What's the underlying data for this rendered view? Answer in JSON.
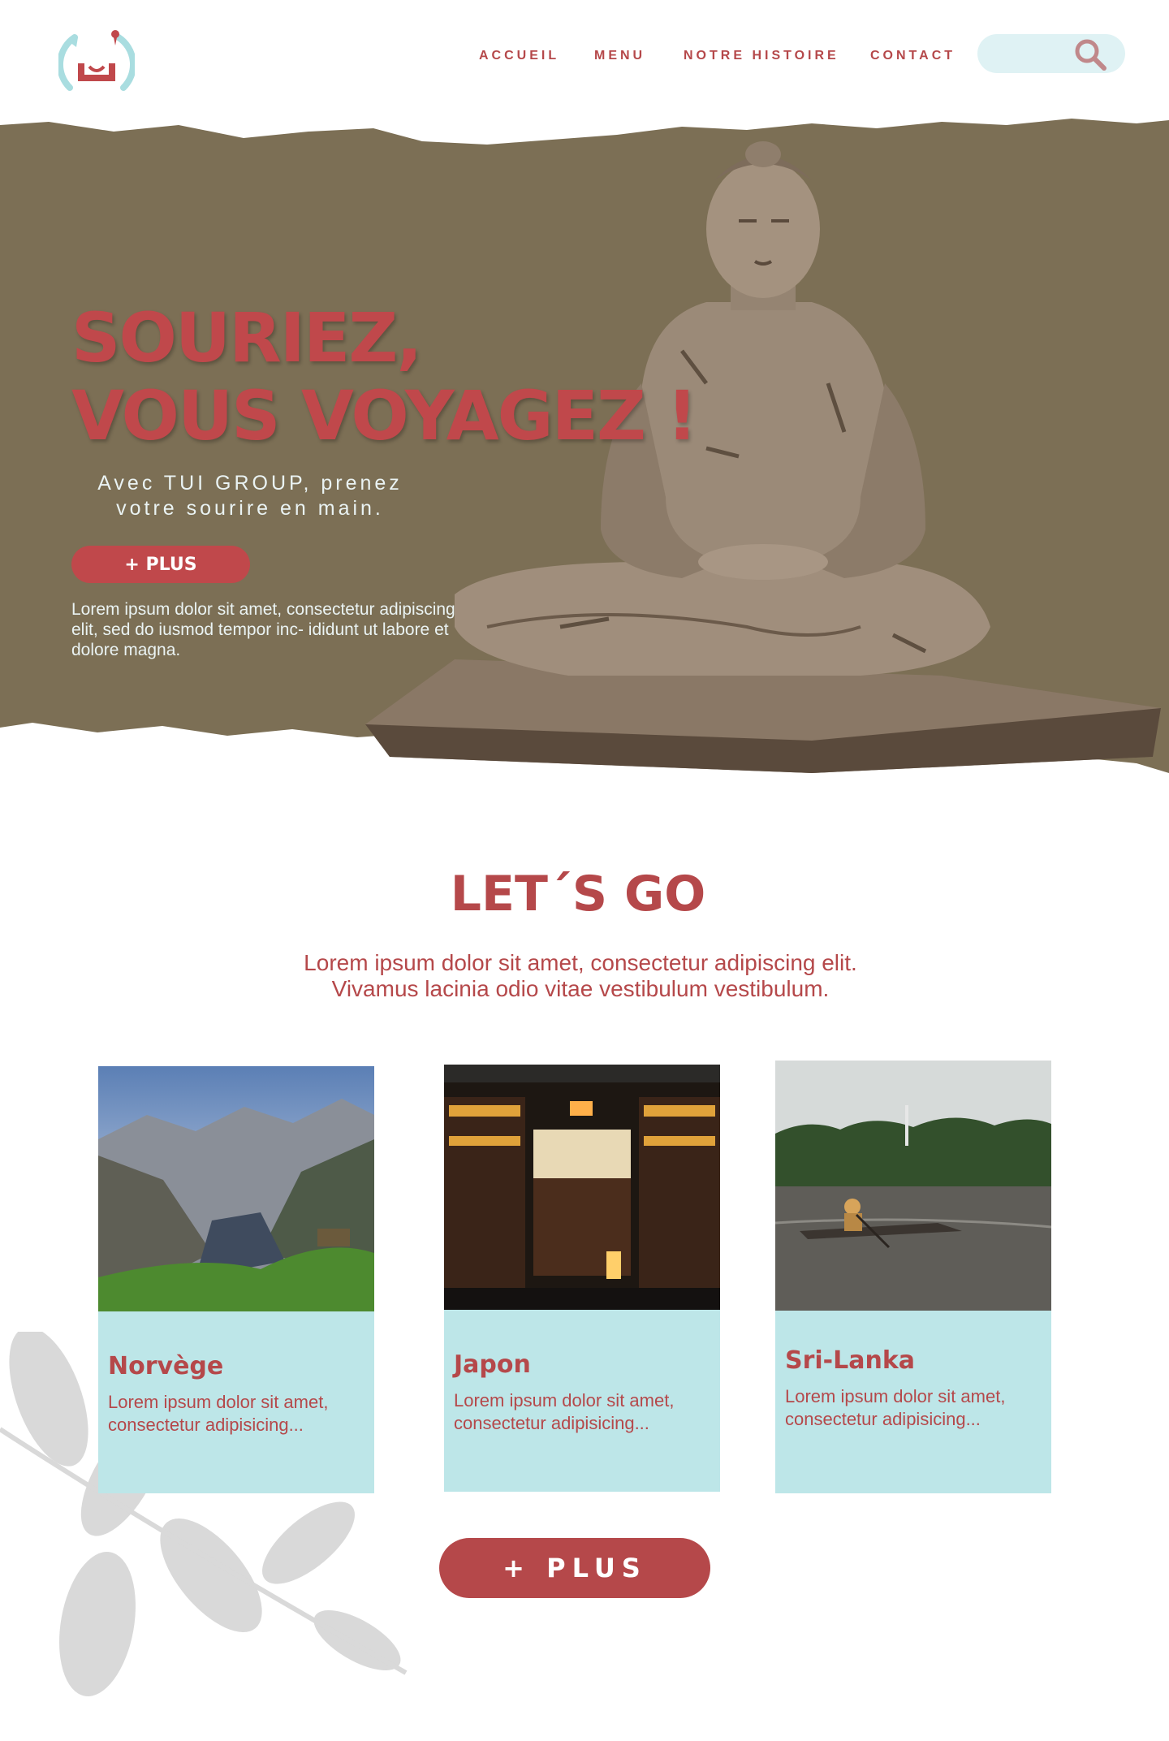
{
  "brand": {
    "logo_icon": "smiling-face-logo",
    "accent": "#c0484b",
    "light_blue": "#bde6e8",
    "hero_bg": "#7c6f55"
  },
  "nav": {
    "items": [
      {
        "label": "ACCUEIL"
      },
      {
        "label": "MENU"
      },
      {
        "label": "NOTRE HISTOIRE"
      },
      {
        "label": "CONTACT"
      }
    ],
    "search_icon": "search-icon"
  },
  "hero": {
    "title_line1": "SOURIEZ,",
    "title_line2": "VOUS VOYAGEZ !",
    "subtitle_line1": "Avec TUI GROUP, prenez",
    "subtitle_line2": "votre sourire en main.",
    "button_label": "+ PLUS",
    "lorem": "Lorem ipsum dolor sit amet, consectetur adipiscing elit, sed do iusmod tempor inc- ididunt ut labore et dolore magna."
  },
  "section": {
    "title": "LET´S GO",
    "text_line1": "Lorem ipsum dolor sit amet, consectetur adipiscing elit.",
    "text_line2": "Vivamus lacinia odio vitae vestibulum vestibulum."
  },
  "cards": [
    {
      "title": "Norvège",
      "text": "Lorem ipsum dolor sit amet, consectetur  adipisicing..."
    },
    {
      "title": "Japon",
      "text": "Lorem ipsum dolor sit amet, consectetur  adipisicing..."
    },
    {
      "title": "Sri-Lanka",
      "text": "Lorem ipsum dolor sit amet, consectetur  adipisicing..."
    }
  ],
  "more_button": {
    "label": "+ PLUS"
  }
}
